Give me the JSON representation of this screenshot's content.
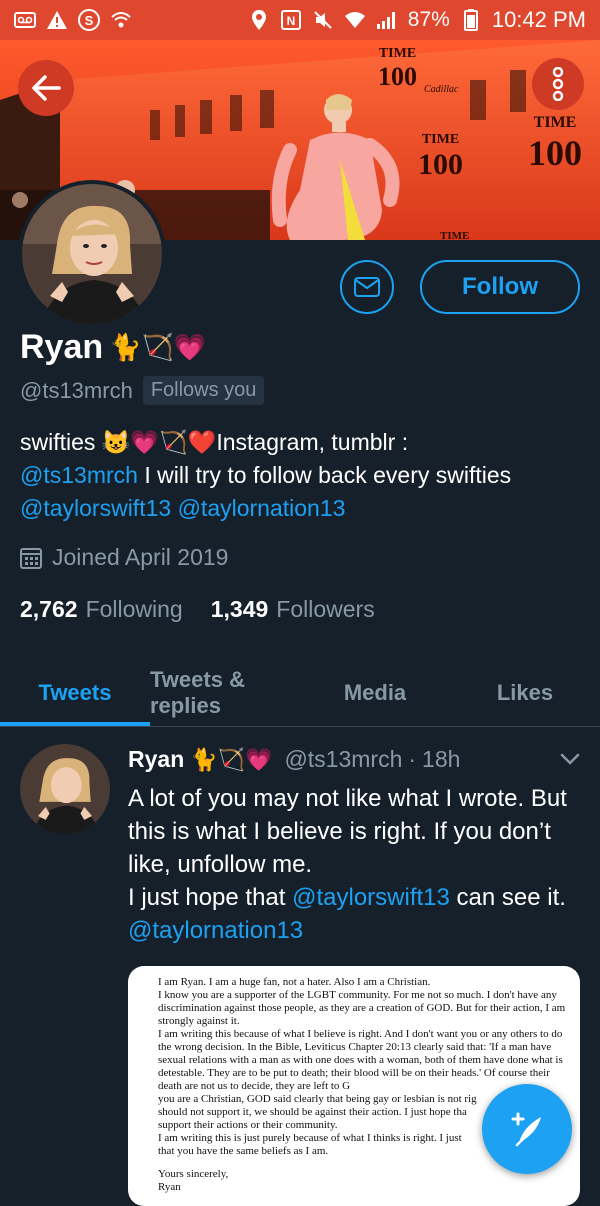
{
  "statusbar": {
    "battery": "87%",
    "time": "10:42 PM",
    "left_icons": [
      "voicemail-icon",
      "warning-icon",
      "s-app-icon",
      "wifi-call-icon"
    ],
    "right_icons": [
      "location-icon",
      "nfc-icon",
      "mute-icon",
      "wifi-icon",
      "signal-icon",
      "battery-icon"
    ]
  },
  "banner": {
    "logo_text": "TIME",
    "logo_number": "100",
    "sub": "Cadillac",
    "partial": "TIME"
  },
  "profile": {
    "name": "Ryan",
    "name_emojis": "🐈🏹💗",
    "handle": "@ts13mrch",
    "follows_you": "Follows you",
    "follow_label": "Follow",
    "bio": {
      "line1_prefix": "swifties ",
      "line1_emojis": "😺💗🏹❤️",
      "line1_suffix": "Instagram, tumblr :",
      "line2_link": "@ts13mrch",
      "line2_text": " I will try to follow back every swifties",
      "line3_link1": "@taylorswift13",
      "line3_link2": "@taylornation13"
    },
    "joined": "Joined April 2019",
    "following_count": "2,762",
    "following_label": "Following",
    "followers_count": "1,349",
    "followers_label": "Followers"
  },
  "tabs": [
    {
      "label": "Tweets",
      "active": true
    },
    {
      "label": "Tweets & replies",
      "active": false
    },
    {
      "label": "Media",
      "active": false
    },
    {
      "label": "Likes",
      "active": false
    }
  ],
  "tweet": {
    "name": "Ryan",
    "name_emojis": "🐈🏹💗",
    "handle": "@ts13mrch",
    "time": "18h",
    "text_1": "A lot of you may not like what I wrote. But this is what I believe is right. If you don’t like, unfollow me.",
    "text_2": "I just hope that ",
    "link_1": "@taylorswift13",
    "text_3": " can see it. ",
    "link_2": "@taylornation13",
    "image_lines": [
      "I am Ryan. I am a huge fan, not a hater. Also I am a Christian.",
      "  I know you are a supporter of the LGBT community. For me not so much. I don't have any discrimination against those people, as they are a creation of GOD. But for their action, I am strongly against it.",
      "  I am writing this because of what I believe is right. And I don't want you or any others to do the wrong decision. In the Bible, Leviticus Chapter 20:13 clearly said that: 'If a man have sexual relations with a man as with one does with a woman, both of them have done what is detestable. They are to be put to death; their blood will be on their heads.' Of course their death are not us to decide, they are left to G",
      "you are a Christian, GOD said clearly that being gay or lesbian is not rig",
      "should not support it, we should be against their action. I just hope tha",
      "support their actions or their community.",
      "  I am writing this is just purely because of what I thinks is right. I just",
      "that you have the same beliefs as I am.",
      "",
      "Yours sincerely,",
      "Ryan"
    ]
  },
  "colors": {
    "accent": "#1da1f2",
    "background": "#15202b",
    "secondary_text": "#8899a6",
    "statusbar": "#e0472f"
  }
}
